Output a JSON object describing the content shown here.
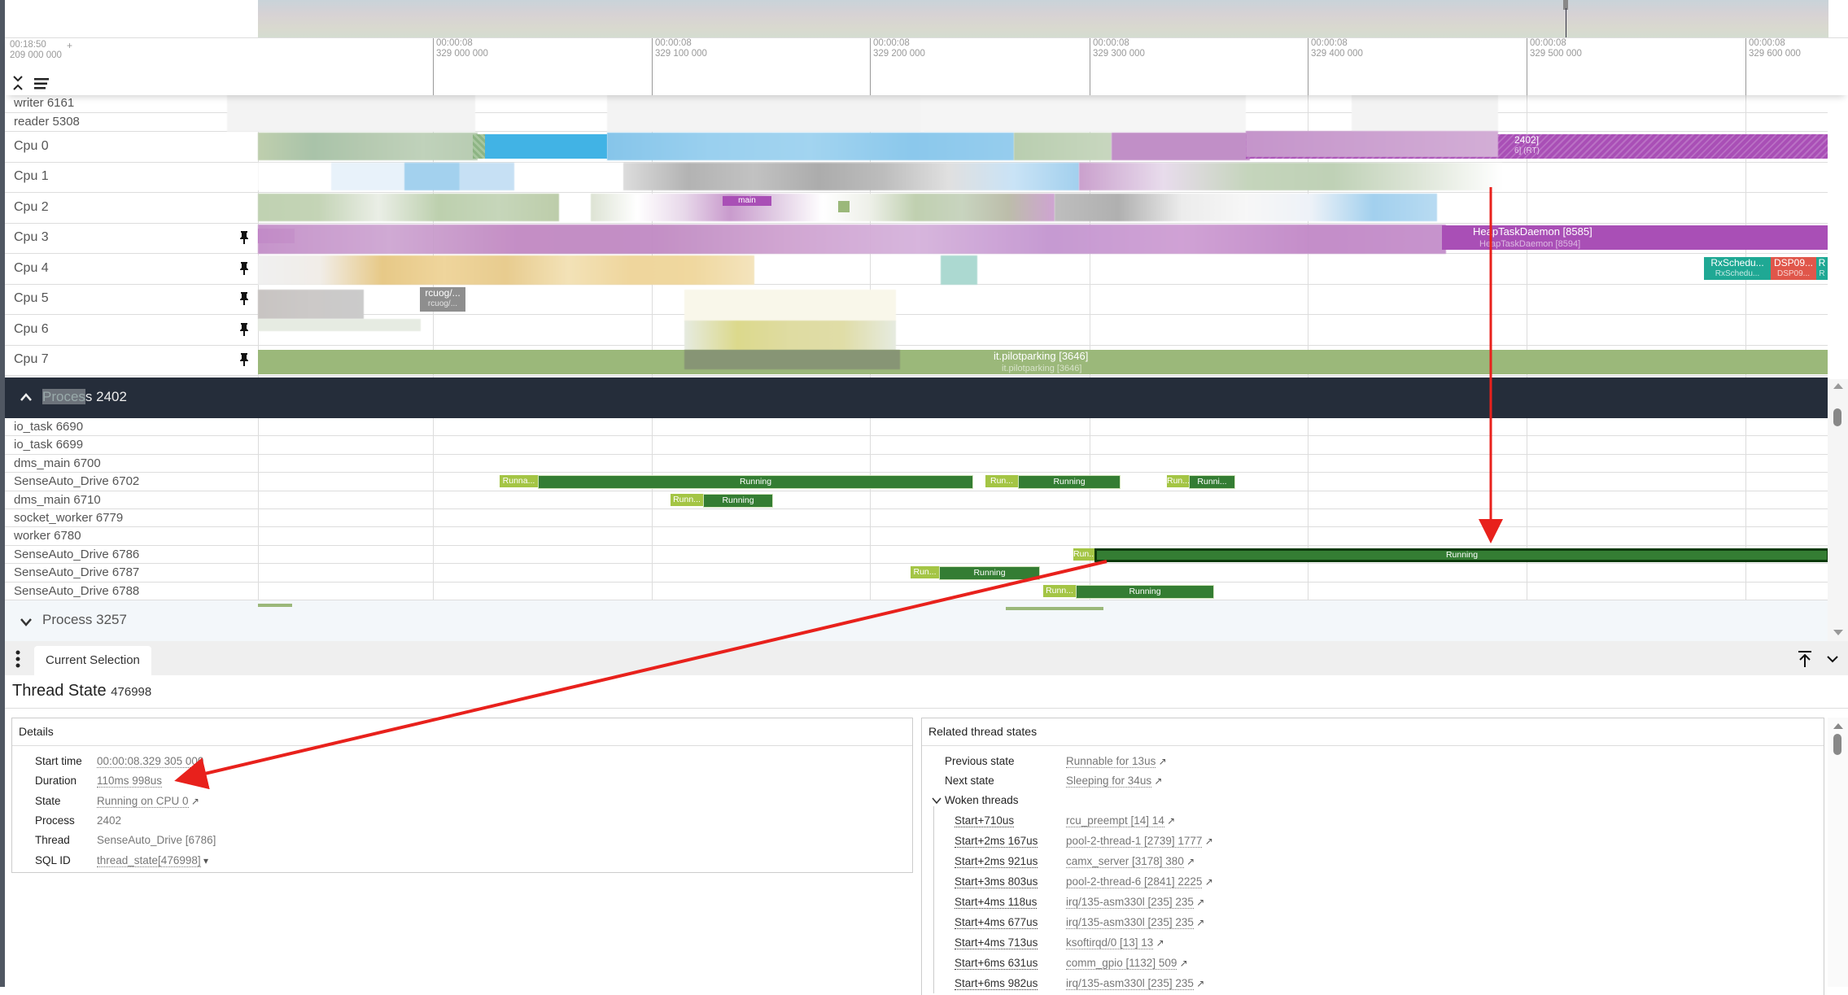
{
  "timeline": {
    "left_time": "00:18:50",
    "left_ns": "209 000 000",
    "left_plus": "+",
    "ticks": [
      {
        "time": "00:00:08",
        "ns": "329 000 000"
      },
      {
        "time": "00:00:08",
        "ns": "329 100 000"
      },
      {
        "time": "00:00:08",
        "ns": "329 200 000"
      },
      {
        "time": "00:00:08",
        "ns": "329 300 000"
      },
      {
        "time": "00:00:08",
        "ns": "329 400 000"
      },
      {
        "time": "00:00:08",
        "ns": "329 500 000"
      },
      {
        "time": "00:00:08",
        "ns": "329 600 000"
      }
    ]
  },
  "tracks": {
    "top_threads": [
      "writer 6161",
      "reader 5308"
    ],
    "cpus": [
      "Cpu 0",
      "Cpu 1",
      "Cpu 2",
      "Cpu 3",
      "Cpu 4",
      "Cpu 5",
      "Cpu 6",
      "Cpu 7"
    ],
    "cpu_slices": {
      "cpu0_right": {
        "title": "2402]",
        "sub": "6] (RT)"
      },
      "cpu3_heap": {
        "title": "HeapTaskDaemon [8585]",
        "sub": "HeapTaskDaemon [8594]"
      },
      "cpu2_main": {
        "title": "main"
      },
      "cpu4_rx": {
        "title": "RxSchedu...",
        "sub": "RxSchedu..."
      },
      "cpu4_dsp": {
        "title": "DSP09...",
        "sub": "DSP09..."
      },
      "cpu4_r": {
        "title": "R",
        "sub": "R"
      },
      "cpu5_rcu": {
        "title": "rcuog/...",
        "sub": "rcuog/..."
      },
      "cpu7_pilot": {
        "title": "it.pilotparking [3646]",
        "sub": "it.pilotparking [3646]"
      }
    },
    "process_expanded": {
      "label_highlight": "Proces",
      "label_rest": "s 2402",
      "threads": [
        {
          "name": "io_task 6690",
          "slices": []
        },
        {
          "name": "io_task 6699",
          "slices": []
        },
        {
          "name": "dms_main 6700",
          "slices": []
        },
        {
          "name": "SenseAuto_Drive 6702",
          "slices": [
            {
              "state": "runnable",
              "label": "Runna..."
            },
            {
              "state": "running",
              "label": "Running"
            },
            {
              "state": "runnable",
              "label": "Run..."
            },
            {
              "state": "running",
              "label": "Running"
            },
            {
              "state": "runnable",
              "label": "Run..."
            },
            {
              "state": "running",
              "label": "Runni..."
            }
          ]
        },
        {
          "name": "dms_main 6710",
          "slices": [
            {
              "state": "runnable",
              "label": "Runn..."
            },
            {
              "state": "running",
              "label": "Running"
            }
          ]
        },
        {
          "name": "socket_worker 6779",
          "slices": []
        },
        {
          "name": "worker 6780",
          "slices": []
        },
        {
          "name": "SenseAuto_Drive 6786",
          "slices": [
            {
              "state": "runnable",
              "label": "Run..."
            },
            {
              "state": "running",
              "label": "Running",
              "selected": true
            }
          ]
        },
        {
          "name": "SenseAuto_Drive 6787",
          "slices": [
            {
              "state": "runnable",
              "label": "Run..."
            },
            {
              "state": "running",
              "label": "Running"
            }
          ]
        },
        {
          "name": "SenseAuto_Drive 6788",
          "slices": [
            {
              "state": "runnable",
              "label": "Runn..."
            },
            {
              "state": "running",
              "label": "Running"
            }
          ]
        }
      ]
    },
    "process_collapsed": {
      "label": "Process 3257"
    }
  },
  "panel": {
    "tab": "Current Selection",
    "title": "Thread State",
    "title_id": "476998",
    "details": {
      "heading": "Details",
      "rows": [
        {
          "key": "Start time",
          "value": "00:00:08.329 305 000",
          "link": true
        },
        {
          "key": "Duration",
          "value": "110ms 998us",
          "link": true
        },
        {
          "key": "State",
          "value": "Running on CPU 0",
          "link": true,
          "arrow": true
        },
        {
          "key": "Process",
          "value": "2402",
          "link": false
        },
        {
          "key": "Thread",
          "value": "SenseAuto_Drive [6786]",
          "link": false
        },
        {
          "key": "SQL ID",
          "value": "thread_state[476998]",
          "link": true,
          "dropdown": true
        }
      ]
    },
    "related": {
      "heading": "Related thread states",
      "previous_label": "Previous state",
      "previous_value": "Runnable for 13us",
      "next_label": "Next state",
      "next_value": "Sleeping for 34us",
      "woken_label": "Woken threads",
      "woken": [
        {
          "time": "Start+710us",
          "thread": "rcu_preempt [14] 14"
        },
        {
          "time": "Start+2ms 167us",
          "thread": "pool-2-thread-1 [2739] 1777"
        },
        {
          "time": "Start+2ms 921us",
          "thread": "camx_server [3178] 380"
        },
        {
          "time": "Start+3ms 803us",
          "thread": "pool-2-thread-6 [2841] 2225"
        },
        {
          "time": "Start+4ms 118us",
          "thread": "irq/135-asm330l [235] 235"
        },
        {
          "time": "Start+4ms 677us",
          "thread": "irq/135-asm330l [235] 235"
        },
        {
          "time": "Start+4ms 713us",
          "thread": "ksoftirqd/0 [13] 13"
        },
        {
          "time": "Start+6ms 631us",
          "thread": "comm_gpio [1132] 509"
        },
        {
          "time": "Start+6ms 982us",
          "thread": "irq/135-asm330l [235] 235"
        }
      ]
    }
  },
  "colors": {
    "running": "#347d33",
    "runnable": "#a4c545",
    "process_header": "#252d3a",
    "annotation_arrow": "#e8211c",
    "heap_purple": "#a94fb6",
    "pilot_green": "#9bb87a"
  }
}
